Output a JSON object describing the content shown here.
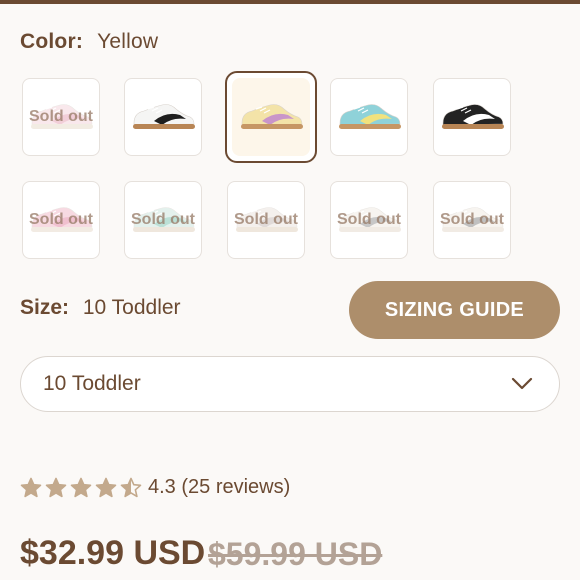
{
  "color": {
    "label": "Color:",
    "value": "Yellow"
  },
  "swatches": [
    {
      "name": "pink-sold-out",
      "sold_out": "Sold out",
      "base": "#f4d6dd",
      "accent": "#e7a7b8",
      "sole": "#e8dccd"
    },
    {
      "name": "white-black",
      "sold_out": "",
      "base": "#f5f5f4",
      "accent": "#1e1e1e",
      "sole": "#b88555"
    },
    {
      "name": "yellow",
      "sold_out": "",
      "base": "#f3e3a8",
      "accent": "#c995c9",
      "sole": "#c69664"
    },
    {
      "name": "teal",
      "sold_out": "",
      "base": "#8fd2d9",
      "accent": "#f1e27e",
      "sole": "#c69664"
    },
    {
      "name": "black",
      "sold_out": "",
      "base": "#232323",
      "accent": "#ffffff",
      "sole": "#b88555"
    },
    {
      "name": "pink-2-sold-out",
      "sold_out": "Sold out",
      "base": "#f1bccb",
      "accent": "#e48da8",
      "sole": "#e8dccd"
    },
    {
      "name": "mint-sold-out",
      "sold_out": "Sold out",
      "base": "#cfe7df",
      "accent": "#86c8b6",
      "sole": "#e2d4c2"
    },
    {
      "name": "grey-sold-out",
      "sold_out": "Sold out",
      "base": "#ece4e0",
      "accent": "#c7bdb9",
      "sole": "#e2d4c2"
    },
    {
      "name": "cream-grey-sold-out",
      "sold_out": "Sold out",
      "base": "#f1ece4",
      "accent": "#9a9a9a",
      "sole": "#e6dccf"
    },
    {
      "name": "cream-grey-2-sold-out",
      "sold_out": "Sold out",
      "base": "#f1ece4",
      "accent": "#8e8e8e",
      "sole": "#e6dccf"
    }
  ],
  "size": {
    "label": "Size:",
    "value": "10 Toddler"
  },
  "sizing_guide": "SIZING GUIDE",
  "size_select": {
    "value": "10 Toddler"
  },
  "rating": {
    "stars": 4.3,
    "text": "4.3 (25 reviews)"
  },
  "price": {
    "current": "$32.99 USD",
    "compare_at": "$59.99 USD"
  },
  "colors": {
    "brand": "#6b4a32",
    "button": "#ad8e6b",
    "star": "#c3a98c",
    "muted": "#b3a296"
  }
}
